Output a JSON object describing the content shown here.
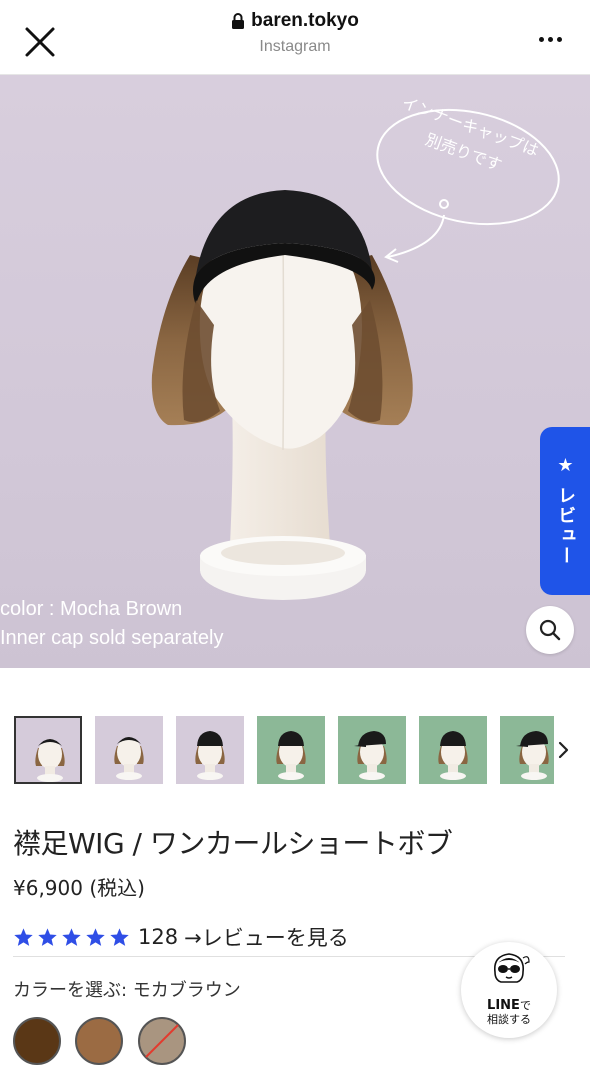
{
  "browser": {
    "domain": "baren.tokyo",
    "source": "Instagram"
  },
  "hero": {
    "bubble_line1": "インナーキャップは",
    "bubble_line2": "別売りです",
    "caption_line1": "color : Mocha Brown",
    "caption_line2": "Inner cap sold separately",
    "review_tab_label": "★ レビュー"
  },
  "thumbnails": [
    {
      "background": "lavender",
      "cap": "headband",
      "selected": true
    },
    {
      "background": "lavender",
      "cap": "headband"
    },
    {
      "background": "lavender",
      "cap": "cap"
    },
    {
      "background": "green",
      "cap": "cap"
    },
    {
      "background": "green",
      "cap": "visor-cap"
    },
    {
      "background": "green",
      "cap": "cap"
    },
    {
      "background": "green",
      "cap": "visor-cap"
    }
  ],
  "product": {
    "title": "襟足WIG / ワンカールショートボブ",
    "price": "¥6,900 (税込)",
    "rating_count": "128",
    "review_link": "→レビューを見る",
    "color_label": "カラーを選ぶ: モカブラウン"
  },
  "swatches": [
    {
      "color": "#5a3716",
      "name": "dark-brown"
    },
    {
      "color": "#9b6b43",
      "name": "mocha-brown"
    },
    {
      "color": "#a99580",
      "name": "grey-brown",
      "sold_out": true
    }
  ],
  "line_button": {
    "title": "LINE",
    "title_suffix": "で",
    "subtitle": "相談する"
  },
  "colors": {
    "accent_blue": "#1f54e8",
    "star_blue": "#2f4ee6",
    "hero_bg": "#d5cbda",
    "thumb_green": "#8cb897"
  },
  "icons": [
    "close-icon",
    "lock-icon",
    "more-icon",
    "search-icon",
    "chevron-right-icon",
    "star-icon"
  ]
}
